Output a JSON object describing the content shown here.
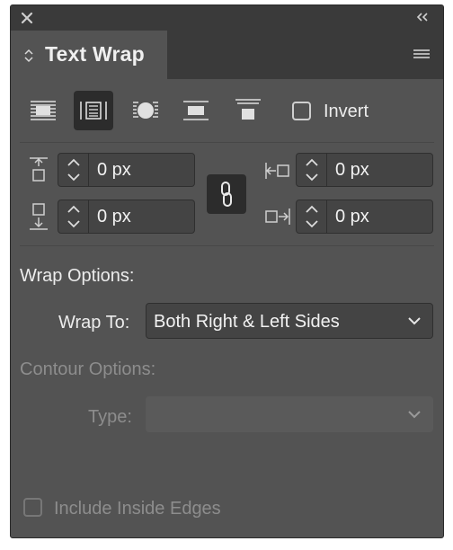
{
  "panel": {
    "title": "Text Wrap"
  },
  "wrap_buttons": [
    {
      "name": "no-text-wrap",
      "active": false
    },
    {
      "name": "wrap-around-bounding-box",
      "active": true
    },
    {
      "name": "wrap-around-object-shape",
      "active": false
    },
    {
      "name": "jump-object",
      "active": false
    },
    {
      "name": "jump-to-next-column",
      "active": false
    }
  ],
  "invert": {
    "label": "Invert",
    "checked": false
  },
  "offsets": {
    "top": "0 px",
    "bottom": "0 px",
    "left": "0 px",
    "right": "0 px",
    "linked": true
  },
  "wrap_options": {
    "heading": "Wrap Options:",
    "wrap_to_label": "Wrap To:",
    "wrap_to_value": "Both Right & Left Sides"
  },
  "contour_options": {
    "heading": "Contour Options:",
    "type_label": "Type:",
    "type_value": "",
    "disabled": true
  },
  "include_inside_edges": {
    "label": "Include Inside Edges",
    "checked": false,
    "disabled": true
  },
  "colors": {
    "panel_bg": "#535353",
    "header_bg": "#3a3a3a",
    "field_bg": "#444444",
    "active_btn_bg": "#2c2c2c",
    "text": "#ececec",
    "disabled_text": "#8d8d8d"
  }
}
